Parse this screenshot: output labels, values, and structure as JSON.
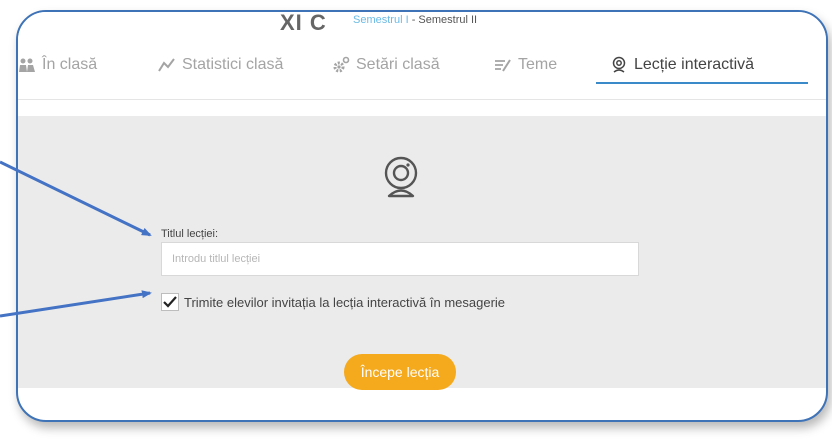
{
  "header": {
    "brand": "XI C",
    "breadcrumb_link": "Semestrul I",
    "breadcrumb_sep": " - ",
    "breadcrumb_current": "Semestrul II"
  },
  "tabs": [
    {
      "label": "În clasă",
      "icon": "people-icon",
      "active": false
    },
    {
      "label": "Statistici clasă",
      "icon": "chart-line-icon",
      "active": false
    },
    {
      "label": "Setări clasă",
      "icon": "gears-icon",
      "active": false
    },
    {
      "label": "Teme",
      "icon": "homework-icon",
      "active": false
    },
    {
      "label": "Lecție interactivă",
      "icon": "webcam-icon",
      "active": true
    }
  ],
  "form": {
    "title_label": "Titlul lecției:",
    "title_placeholder": "Introdu titlul lecției",
    "title_value": "",
    "invite_label": "Trimite elevilor invitația la lecția interactivă în mesagerie",
    "invite_checked": true,
    "start_button": "Începe lecția"
  },
  "colors": {
    "accent": "#f5a91c",
    "tab_underline": "#3a89c9",
    "frame_border": "#3e73b8",
    "arrow": "#4472c4"
  }
}
